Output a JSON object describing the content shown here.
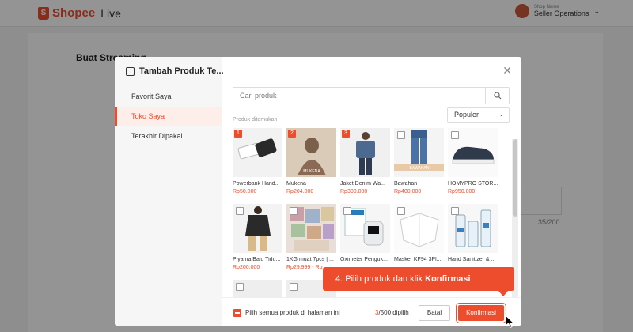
{
  "app": {
    "brand": "Shopee",
    "product": "Live",
    "brand_color": "#ee4d2d"
  },
  "user": {
    "shop_label": "Shop Name",
    "name": "Seller Operations"
  },
  "page": {
    "title": "Buat Streaming",
    "char_count": "35/200"
  },
  "modal": {
    "title": "Tambah Produk Te...",
    "sidebar": [
      {
        "label": "Favorit Saya",
        "active": false
      },
      {
        "label": "Toko Saya",
        "active": true
      },
      {
        "label": "Terakhir Dipakai",
        "active": false
      }
    ],
    "search_placeholder": "Cari produk",
    "found_label": "Produk ditemukan",
    "sort_value": "Populer",
    "products": [
      {
        "name": "Powerbank Hand...",
        "price": "Rp50.000",
        "order": "1",
        "selected": true,
        "thumb_label": ""
      },
      {
        "name": "Mukena",
        "price": "Rp204.000",
        "order": "2",
        "selected": true,
        "thumb_label": "MUKENA"
      },
      {
        "name": "Jaket Denim Wa...",
        "price": "Rp300.000",
        "order": "3",
        "selected": true,
        "thumb_label": ""
      },
      {
        "name": "Bawahan",
        "price": "Rp400.000",
        "order": "",
        "selected": false,
        "thumb_label": "BAWAHAN"
      },
      {
        "name": "HOMYPRO STOR...",
        "price": "Rp950.000",
        "order": "",
        "selected": false,
        "thumb_label": ""
      },
      {
        "name": "Piyama Baju Tidu...",
        "price": "Rp200.000",
        "order": "",
        "selected": false,
        "thumb_label": ""
      },
      {
        "name": "1KG muat 7pcs | ...",
        "price": "Rp29.999 - Rp",
        "order": "",
        "selected": false,
        "thumb_label": ""
      },
      {
        "name": "Oximeter Penguk...",
        "price": "",
        "order": "",
        "selected": false,
        "thumb_label": ""
      },
      {
        "name": "Masker KF94 3Pl...",
        "price": "",
        "order": "",
        "selected": false,
        "thumb_label": ""
      },
      {
        "name": "Hand Sanitizer & ...",
        "price": "",
        "order": "",
        "selected": false,
        "thumb_label": ""
      }
    ],
    "footer": {
      "select_all_label": "Pilih semua produk di halaman ini",
      "count_selected": "3",
      "count_total": "/500",
      "count_suffix": "dipilih",
      "cancel_label": "Batal",
      "confirm_label": "Konfirmasi"
    }
  },
  "callout": {
    "prefix": "4. Pilih produk dan klik ",
    "emphasis": "Konfirmasi"
  }
}
